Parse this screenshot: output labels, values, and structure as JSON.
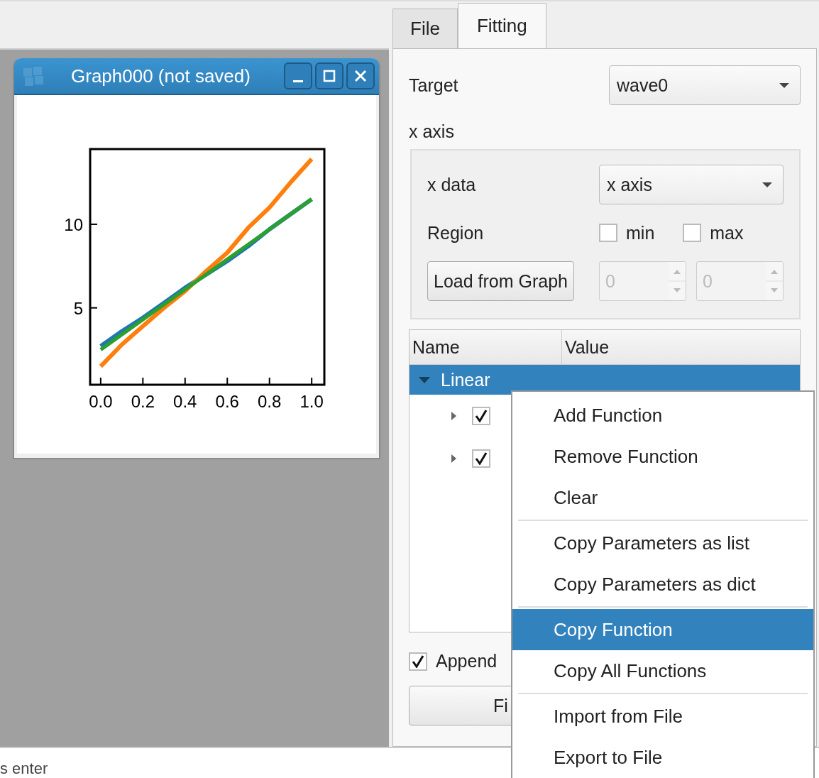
{
  "tabs": [
    {
      "label": "File",
      "selected": false
    },
    {
      "label": "Fitting",
      "selected": true
    }
  ],
  "graph_window": {
    "title": "Graph000 (not saved)",
    "chart_data": {
      "type": "line",
      "x": [
        0,
        0.1,
        0.2,
        0.3,
        0.4,
        0.5,
        0.6,
        0.7,
        0.8,
        0.9,
        1.0
      ],
      "xlim": [
        -0.05,
        1.06
      ],
      "ylim": [
        0.4,
        14.5
      ],
      "xticks": [
        {
          "value": 0,
          "label": "0.0"
        },
        {
          "value": 0.2,
          "label": "0.2"
        },
        {
          "value": 0.4,
          "label": "0.4"
        },
        {
          "value": 0.6,
          "label": "0.6"
        },
        {
          "value": 0.8,
          "label": "0.8"
        },
        {
          "value": 1,
          "label": "1.0"
        }
      ],
      "yticks": [
        5,
        10
      ],
      "series": [
        {
          "color": "#1f77b4",
          "values": [
            2.7,
            3.6,
            4.4,
            5.3,
            6.2,
            7.0,
            7.8,
            8.7,
            9.7,
            10.6,
            11.5
          ]
        },
        {
          "color": "#ff7f0e",
          "values": [
            1.5,
            2.8,
            3.9,
            5.0,
            6.0,
            7.2,
            8.3,
            9.8,
            11.0,
            12.5,
            13.9
          ]
        },
        {
          "color": "#2ca02c",
          "values": [
            2.5,
            3.4,
            4.3,
            5.2,
            6.1,
            7.0,
            7.9,
            8.8,
            9.7,
            10.6,
            11.5
          ]
        }
      ]
    }
  },
  "fitting": {
    "target_label": "Target",
    "target_value": "wave0",
    "x_axis_label": "x axis",
    "x_data_label": "x data",
    "x_data_value": "x axis",
    "region_label": "Region",
    "min": {
      "label": "min",
      "checked": false,
      "value": "0"
    },
    "max": {
      "label": "max",
      "checked": false,
      "value": "0"
    },
    "load_button": "Load from Graph",
    "tree": {
      "columns": [
        "Name",
        "Value"
      ],
      "rows": [
        {
          "name": "Linear",
          "selected": true,
          "expanded": true,
          "children": [
            {
              "checked": true,
              "expanded": false
            },
            {
              "checked": true,
              "expanded": false
            }
          ]
        }
      ]
    },
    "append": {
      "label": "Append",
      "checked": true
    },
    "fit_button": "Fi"
  },
  "status_text": "s enter",
  "context_menu": [
    [
      {
        "label": "Add Function",
        "selected": false
      },
      {
        "label": "Remove Function",
        "selected": false
      },
      {
        "label": "Clear",
        "selected": false
      }
    ],
    [
      {
        "label": "Copy Parameters as list",
        "selected": false
      },
      {
        "label": "Copy Parameters as dict",
        "selected": false
      }
    ],
    [
      {
        "label": "Copy Function",
        "selected": true
      },
      {
        "label": "Copy All Functions",
        "selected": false
      }
    ],
    [
      {
        "label": "Import from File",
        "selected": false
      },
      {
        "label": "Export to File",
        "selected": false
      }
    ]
  ]
}
